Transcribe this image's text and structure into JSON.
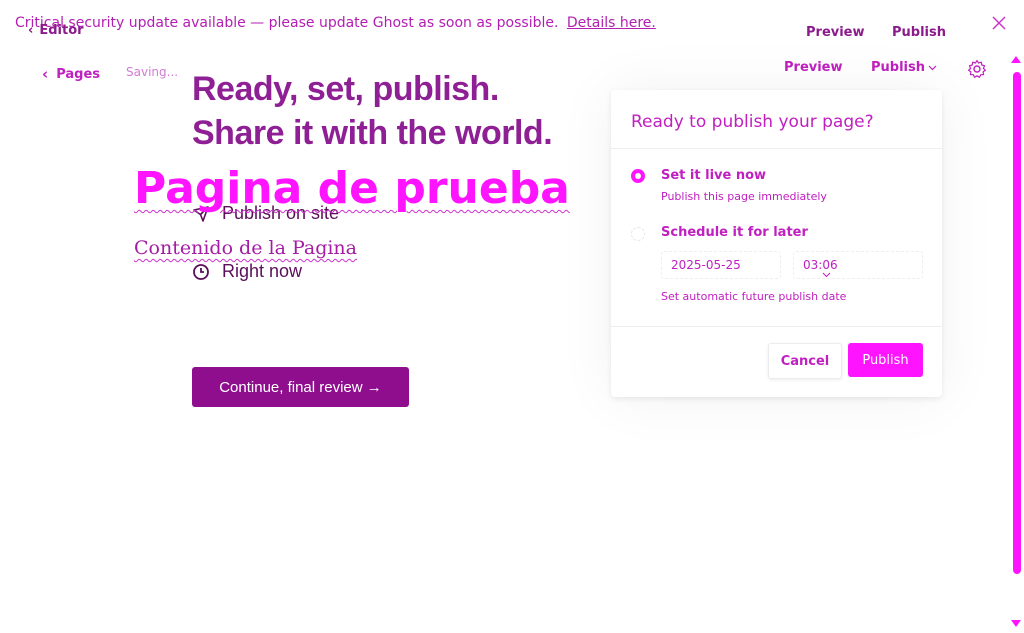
{
  "banner": {
    "text": "Critical security update available — please update Ghost as soon as possible.",
    "link": "Details here."
  },
  "topbar": {
    "editor_label": "Editor",
    "preview_label": "Preview",
    "publish_label": "Publish"
  },
  "navbar": {
    "pages_label": "Pages",
    "status": "Saving...",
    "preview_label": "Preview",
    "publish_label": "Publish"
  },
  "flow": {
    "headline_line1": "Ready, set, publish.",
    "headline_line2": "Share it with the world.",
    "option_publish": "Publish on site",
    "option_time": "Right now",
    "continue_label": "Continue, final review →"
  },
  "page": {
    "title": "Pagina de prueba",
    "body": "Contenido de la Pagina"
  },
  "popover": {
    "title": "Ready to publish your page?",
    "option_now_title": "Set it live now",
    "option_now_sub": "Publish this page immediately",
    "option_later_title": "Schedule it for later",
    "date_value": "2025-05-25",
    "time_value": "03:06",
    "schedule_sub": "Set automatic future publish date",
    "cancel_label": "Cancel",
    "publish_label": "Publish"
  },
  "colors": {
    "accent": "#ff14ff",
    "accent_text": "#c020c0",
    "dark_accent": "#8e0e8e"
  }
}
